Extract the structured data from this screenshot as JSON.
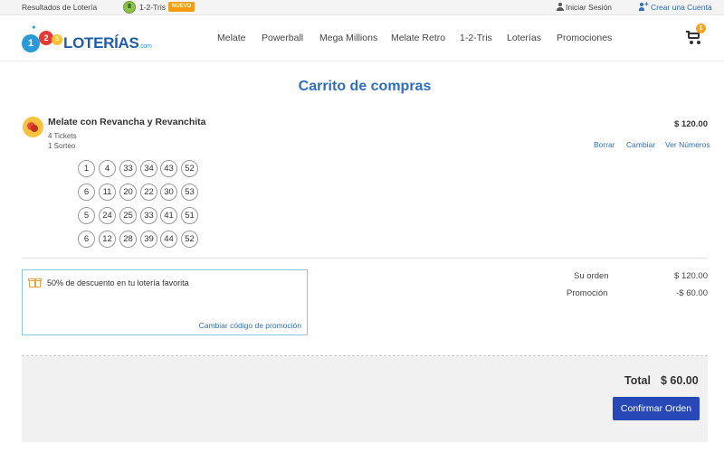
{
  "topbar": {
    "results_link": "Resultados de Lotería",
    "tris_badge": "8",
    "tris_label": "1-2-Tris",
    "new_badge": "NUEVO",
    "login": "Iniciar Sesión",
    "signup": "Crear una Cuenta"
  },
  "header": {
    "logo": {
      "b1": "1",
      "b2": "2",
      "b3": "3",
      "word": "LOTERÍAS",
      "suffix": ".com"
    },
    "nav": [
      "Melate",
      "Powerball",
      "Mega Millions",
      "Melate Retro",
      "1-2-Tris",
      "Loterías",
      "Promociones"
    ],
    "cart_count": "1"
  },
  "page": {
    "title": "Carrito de compras"
  },
  "item": {
    "name": "Melate con Revancha y Revanchita",
    "tickets": "4 Tickets",
    "draws": "1 Sorteo",
    "price": "$ 120.00",
    "actions": {
      "delete": "Borrar",
      "change": "Cambiar",
      "view": "Ver Números"
    },
    "lines": [
      [
        "1",
        "4",
        "33",
        "34",
        "43",
        "52"
      ],
      [
        "6",
        "11",
        "20",
        "22",
        "30",
        "53"
      ],
      [
        "5",
        "24",
        "25",
        "33",
        "41",
        "51"
      ],
      [
        "6",
        "12",
        "28",
        "39",
        "44",
        "52"
      ]
    ]
  },
  "promo": {
    "text": "50% de descuento en tu lotería favorita",
    "change_link": "Cambiar código de promoción"
  },
  "summary": {
    "order_label": "Su orden",
    "order_value": "$ 120.00",
    "promo_label": "Promoción",
    "promo_value": "-$ 60.00"
  },
  "total": {
    "label": "Total",
    "value": "$ 60.00",
    "confirm": "Confirmar Orden"
  }
}
